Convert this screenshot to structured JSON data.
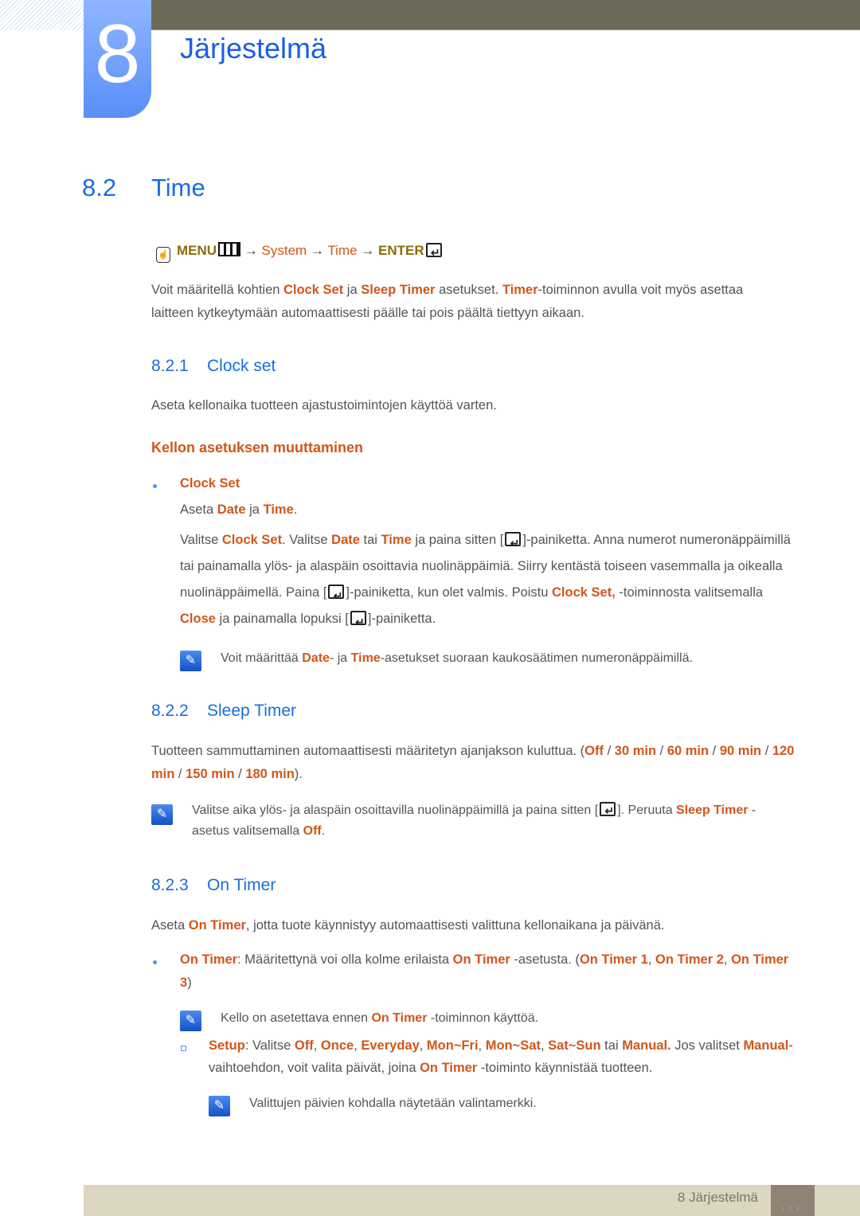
{
  "chapter": {
    "number": "8",
    "title": "Järjestelmä"
  },
  "section": {
    "number": "8.2",
    "title": "Time"
  },
  "menu_path": {
    "menu": "MENU",
    "arrow": "→",
    "system": "System",
    "time": "Time",
    "enter": "ENTER"
  },
  "intro": [
    {
      "t": "Voit määritellä kohtien "
    },
    {
      "t": "Clock Set",
      "h": 1
    },
    {
      "t": " ja "
    },
    {
      "t": "Sleep Timer",
      "h": 1
    },
    {
      "t": " asetukset. "
    },
    {
      "t": "Timer",
      "h": 1
    },
    {
      "t": "-toiminnon avulla voit myös asettaa laitteen kytkeytymään automaattisesti päälle tai pois päältä tiettyyn aikaan."
    }
  ],
  "clock": {
    "number": "8.2.1",
    "title": "Clock set",
    "desc": [
      {
        "t": "Aseta kellonaika tuotteen ajastustoimintojen käyttöä varten."
      }
    ],
    "subheading": "Kellon asetuksen muuttaminen",
    "bullet": "Clock Set",
    "line1": [
      {
        "t": "Aseta "
      },
      {
        "t": "Date",
        "h": 1
      },
      {
        "t": " ja "
      },
      {
        "t": "Time",
        "h": 1
      },
      {
        "t": "."
      }
    ],
    "para": [
      {
        "t": "Valitse "
      },
      {
        "t": "Clock Set",
        "h": 1
      },
      {
        "t": ". Valitse "
      },
      {
        "t": "Date",
        "h": 1
      },
      {
        "t": " tai "
      },
      {
        "t": "Time",
        "h": 1
      },
      {
        "t": " ja paina sitten ["
      },
      {
        "i": "enter"
      },
      {
        "t": "]-painiketta. Anna numerot numeronäppäimillä tai painamalla ylös- ja alaspäin osoittavia nuolinäppäimiä. Siirry kentästä toiseen vasemmalla ja oikealla nuolinäppäimellä. Paina ["
      },
      {
        "i": "enter"
      },
      {
        "t": "]-painiketta, kun olet valmis. Poistu "
      },
      {
        "t": "Clock Set,",
        "h": 1
      },
      {
        "t": " -toiminnosta valitsemalla "
      },
      {
        "t": "Close",
        "h": 1
      },
      {
        "t": " ja painamalla lopuksi ["
      },
      {
        "i": "enter"
      },
      {
        "t": "]-painiketta."
      }
    ],
    "note": [
      {
        "t": "Voit määrittää "
      },
      {
        "t": "Date",
        "h": 1
      },
      {
        "t": "- ja "
      },
      {
        "t": "Time",
        "h": 1
      },
      {
        "t": "-asetukset suoraan kaukosäätimen numeronäppäimillä."
      }
    ]
  },
  "sleep": {
    "number": "8.2.2",
    "title": "Sleep Timer",
    "desc": [
      {
        "t": "Tuotteen sammuttaminen automaattisesti määritetyn ajanjakson kuluttua. ("
      },
      {
        "t": "Off",
        "h": 1
      },
      {
        "t": " / "
      },
      {
        "t": "30 min",
        "h": 1
      },
      {
        "t": " / "
      },
      {
        "t": "60 min",
        "h": 1
      },
      {
        "t": " / "
      },
      {
        "t": "90 min",
        "h": 1
      },
      {
        "t": " / "
      },
      {
        "t": "120 min",
        "h": 1
      },
      {
        "t": " / "
      },
      {
        "t": "150 min",
        "h": 1
      },
      {
        "t": " / "
      },
      {
        "t": "180 min",
        "h": 1
      },
      {
        "t": ")."
      }
    ],
    "note": [
      {
        "t": "Valitse aika ylös- ja alaspäin osoittavilla nuolinäppäimillä ja paina sitten ["
      },
      {
        "i": "enter"
      },
      {
        "t": "]. Peruuta "
      },
      {
        "t": "Sleep Timer",
        "h": 1
      },
      {
        "t": " -asetus valitsemalla "
      },
      {
        "t": "Off",
        "h": 1
      },
      {
        "t": "."
      }
    ]
  },
  "ontimer": {
    "number": "8.2.3",
    "title": "On Timer",
    "desc": [
      {
        "t": "Aseta "
      },
      {
        "t": "On Timer",
        "h": 1
      },
      {
        "t": ", jotta tuote käynnistyy automaattisesti valittuna kellonaikana ja päivänä."
      }
    ],
    "bullet": [
      {
        "t": "On Timer",
        "h": 1
      },
      {
        "t": ": Määritettynä voi olla kolme erilaista "
      },
      {
        "t": "On Timer",
        "h": 1
      },
      {
        "t": " -asetusta. ("
      },
      {
        "t": "On Timer 1",
        "h": 1
      },
      {
        "t": ", "
      },
      {
        "t": "On Timer 2",
        "h": 1
      },
      {
        "t": ", "
      },
      {
        "t": "On Timer 3",
        "h": 1
      },
      {
        "t": ")"
      }
    ],
    "note1": [
      {
        "t": "Kello on asetettava ennen "
      },
      {
        "t": "On Timer",
        "h": 1
      },
      {
        "t": " -toiminnon käyttöä."
      }
    ],
    "setup": [
      {
        "t": "Setup",
        "h": 1
      },
      {
        "t": ": Valitse "
      },
      {
        "t": "Off",
        "h": 1
      },
      {
        "t": ", "
      },
      {
        "t": "Once",
        "h": 1
      },
      {
        "t": ", "
      },
      {
        "t": "Everyday",
        "h": 1
      },
      {
        "t": ", "
      },
      {
        "t": "Mon~Fri",
        "h": 1
      },
      {
        "t": ", "
      },
      {
        "t": "Mon~Sat",
        "h": 1
      },
      {
        "t": ", "
      },
      {
        "t": "Sat~Sun",
        "h": 1
      },
      {
        "t": " tai "
      },
      {
        "t": "Manual.",
        "h": 1
      },
      {
        "t": " Jos valitset "
      },
      {
        "t": "Manual",
        "h": 1
      },
      {
        "t": "-vaihtoehdon, voit valita päivät, joina "
      },
      {
        "t": "On Timer",
        "h": 1
      },
      {
        "t": " -toiminto käynnistää tuotteen."
      }
    ],
    "note2": [
      {
        "t": "Valittujen päivien kohdalla näytetään valintamerkki."
      }
    ]
  },
  "footer": {
    "label": "8 Järjestelmä",
    "page": "123"
  },
  "colors": {
    "heading": "#1a6de0",
    "highlight": "#d2561a",
    "menu": "#8a6d0b",
    "footer": "#ddd6c1"
  }
}
